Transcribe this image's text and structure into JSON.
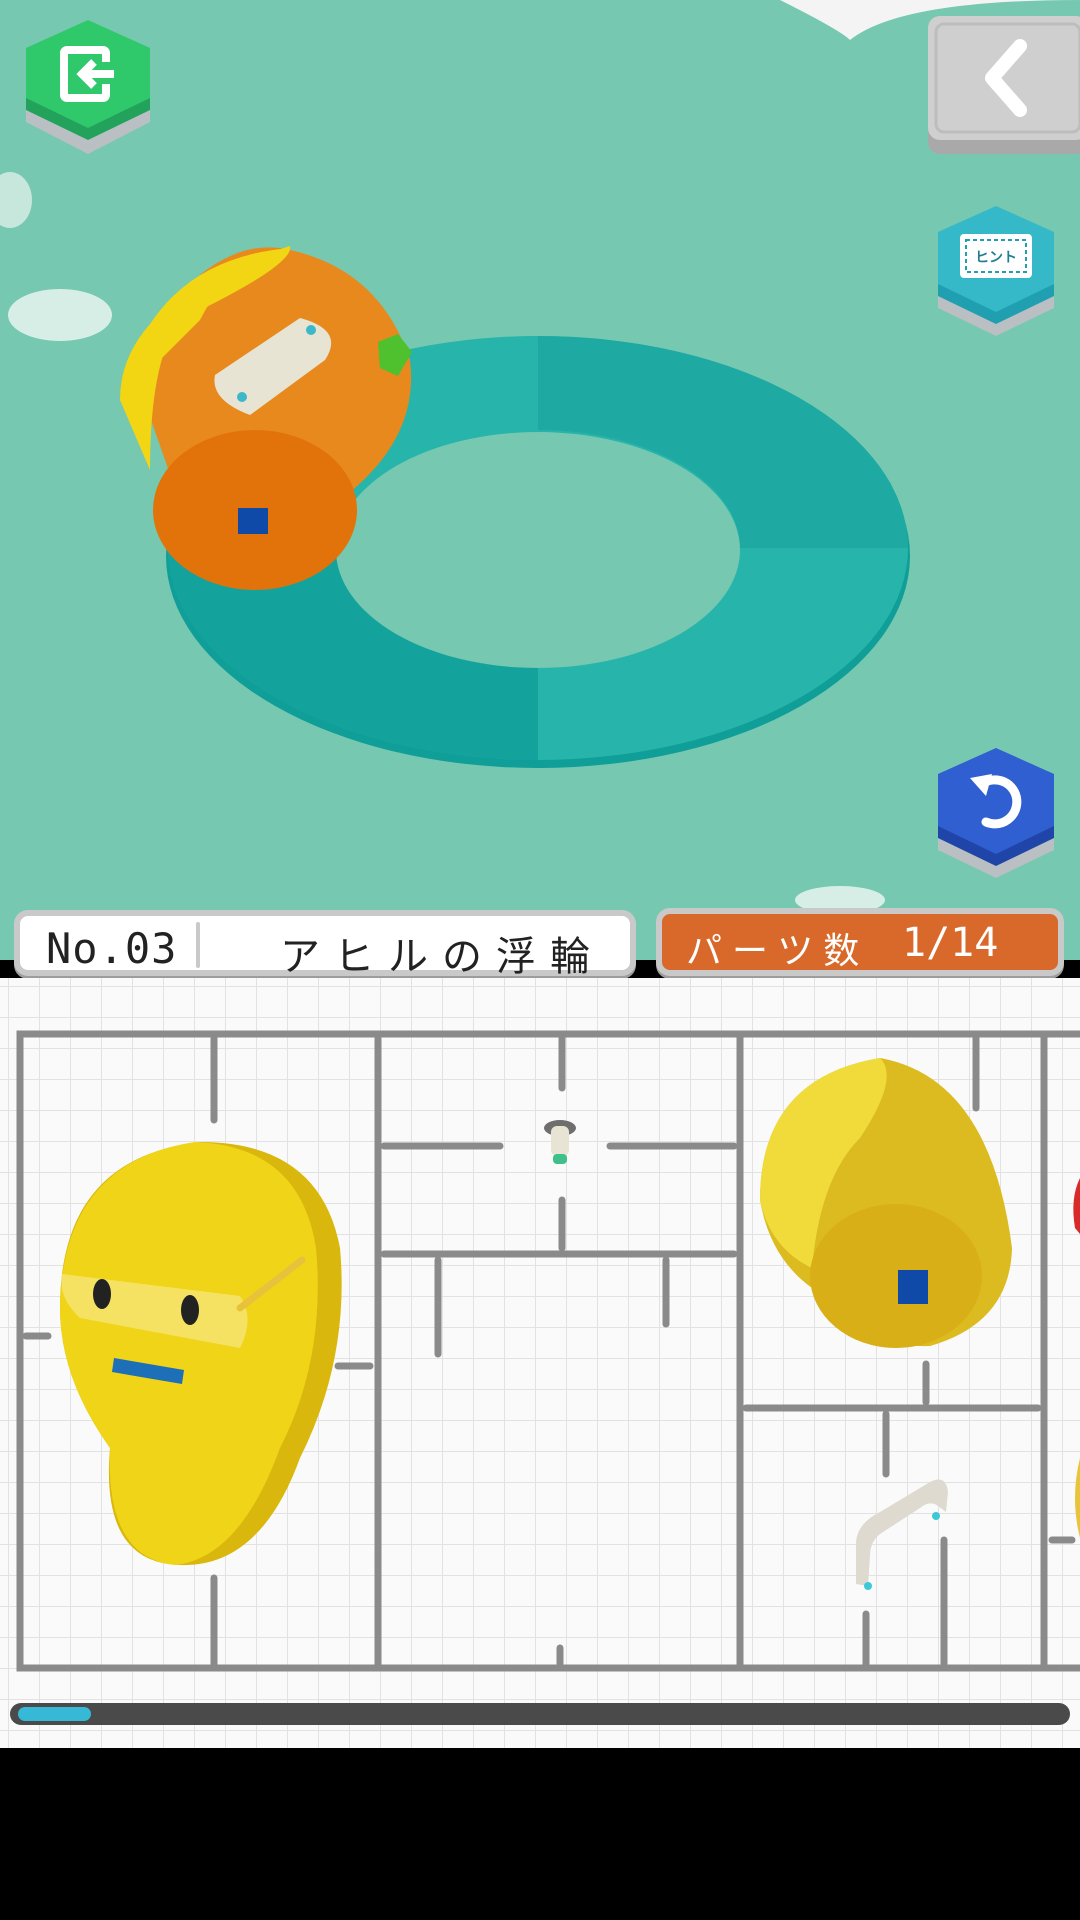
{
  "header": {
    "number": "No.03",
    "title": "アヒルの浮輪",
    "parts_label": "パーツ数",
    "parts_count": "1/14"
  },
  "progress": {
    "fraction": 0.07
  },
  "buttons": {
    "exit": "exit-icon",
    "back": "chevron-left-icon",
    "hint": "hint-icon",
    "hint_text": "ヒント",
    "undo": "undo-icon"
  },
  "colors": {
    "scene_bg": "#76c8b0",
    "ring": "#27b4ab",
    "duck_orange": "#e8891e",
    "duck_yellow": "#f2d614",
    "parts_panel": "#d8692a",
    "progress_fill": "#35b9d6",
    "exit_button": "#2fc86a",
    "undo_button": "#2f5fd0"
  }
}
